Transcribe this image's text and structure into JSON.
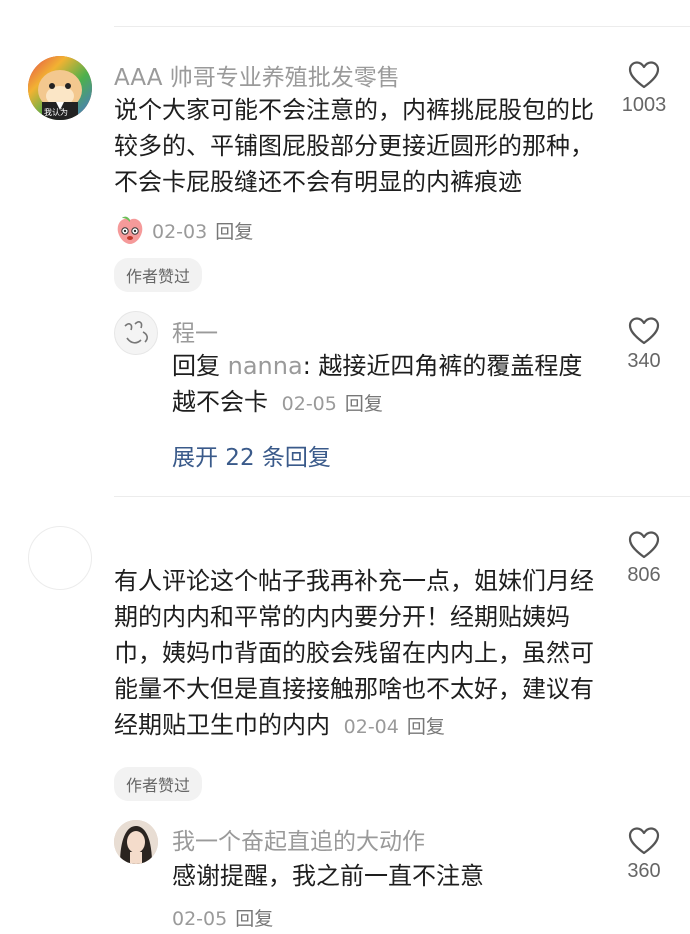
{
  "comments": [
    {
      "username": "AAA 帅哥专业养殖批发零售",
      "avatar_caption": "我认为",
      "text": "说个大家可能不会注意的，内裤挑屁股包的比较多的、平铺图屁股部分更接近圆形的那种，不会卡屁股缝还不会有明显的内裤痕迹",
      "sticker_icon": "peach-emoji-icon",
      "date": "02-03",
      "reply_label": "回复",
      "likes": "1003",
      "author_badge": "作者赞过",
      "sub_reply": {
        "username": "程一",
        "prefix": "回复",
        "target_user": "nanna",
        "text": ": 越接近四角裤的覆盖程度越不会卡",
        "date": "02-05",
        "reply_label": "回复",
        "likes": "340"
      },
      "expand_label": "展开 22 条回复"
    },
    {
      "username": "",
      "text": "有人评论这个帖子我再补充一点，姐妹们月经期的内内和平常的内内要分开！经期贴姨妈巾，姨妈巾背面的胶会残留在内内上，虽然可能量不大但是直接接触那啥也不太好，建议有经期贴卫生巾的内内",
      "date": "02-04",
      "reply_label": "回复",
      "likes": "806",
      "author_badge": "作者赞过",
      "sub_reply": {
        "username": "我一个奋起直追的大动作",
        "text": "感谢提醒，我之前一直不注意",
        "date": "02-05",
        "reply_label": "回复",
        "likes": "360"
      }
    }
  ],
  "colors": {
    "link": "#3a5a8a",
    "muted": "#9a9a9a",
    "badge_bg": "#f2f2f2"
  }
}
